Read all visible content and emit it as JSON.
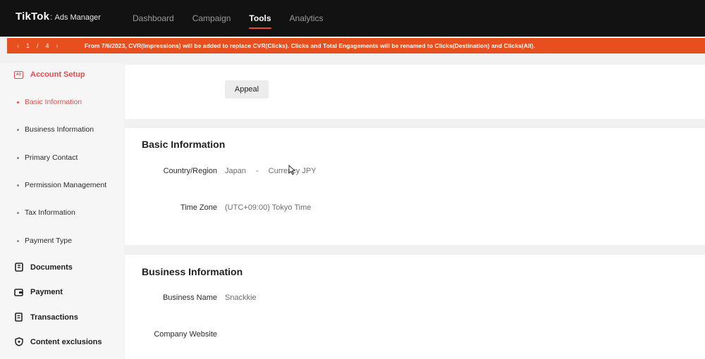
{
  "header": {
    "brand": "TikTok",
    "product": "Ads Manager",
    "nav": [
      {
        "label": "Dashboard",
        "active": false
      },
      {
        "label": "Campaign",
        "active": false
      },
      {
        "label": "Tools",
        "active": true
      },
      {
        "label": "Analytics",
        "active": false
      }
    ]
  },
  "banner": {
    "current": "1",
    "slash": "/",
    "total": "4",
    "prev_icon": "chevron-left-icon",
    "next_icon": "chevron-right-icon",
    "message": "From 7/6/2023, CVR(Impressions) will be added to replace CVR(Clicks). Clicks and Total Engagements will be renamed to Clicks(Destination) and Clicks(All).",
    "color": "#e84f1e"
  },
  "sidebar": {
    "section": {
      "label": "Account Setup",
      "icon": "ad-account-icon"
    },
    "sub_items": [
      {
        "label": "Basic Information",
        "active": true
      },
      {
        "label": "Business Information",
        "active": false
      },
      {
        "label": "Primary Contact",
        "active": false
      },
      {
        "label": "Permission Management",
        "active": false
      },
      {
        "label": "Tax Information",
        "active": false
      },
      {
        "label": "Payment Type",
        "active": false
      }
    ],
    "items": [
      {
        "label": "Documents",
        "icon": "document-icon"
      },
      {
        "label": "Payment",
        "icon": "wallet-icon"
      },
      {
        "label": "Transactions",
        "icon": "receipt-icon"
      },
      {
        "label": "Content exclusions",
        "icon": "shield-icon"
      }
    ]
  },
  "appeal": {
    "button_label": "Appeal"
  },
  "basic_info": {
    "title": "Basic Information",
    "country_label": "Country/Region",
    "country_value": "Japan",
    "separator": "-",
    "currency_value": "Currency JPY",
    "timezone_label": "Time Zone",
    "timezone_value": "(UTC+09:00) Tokyo Time"
  },
  "business_info": {
    "title": "Business Information",
    "name_label": "Business Name",
    "name_value": "Snackkie",
    "website_label": "Company Website"
  },
  "colors": {
    "accent": "#e14d4d",
    "topbar": "#121212"
  }
}
